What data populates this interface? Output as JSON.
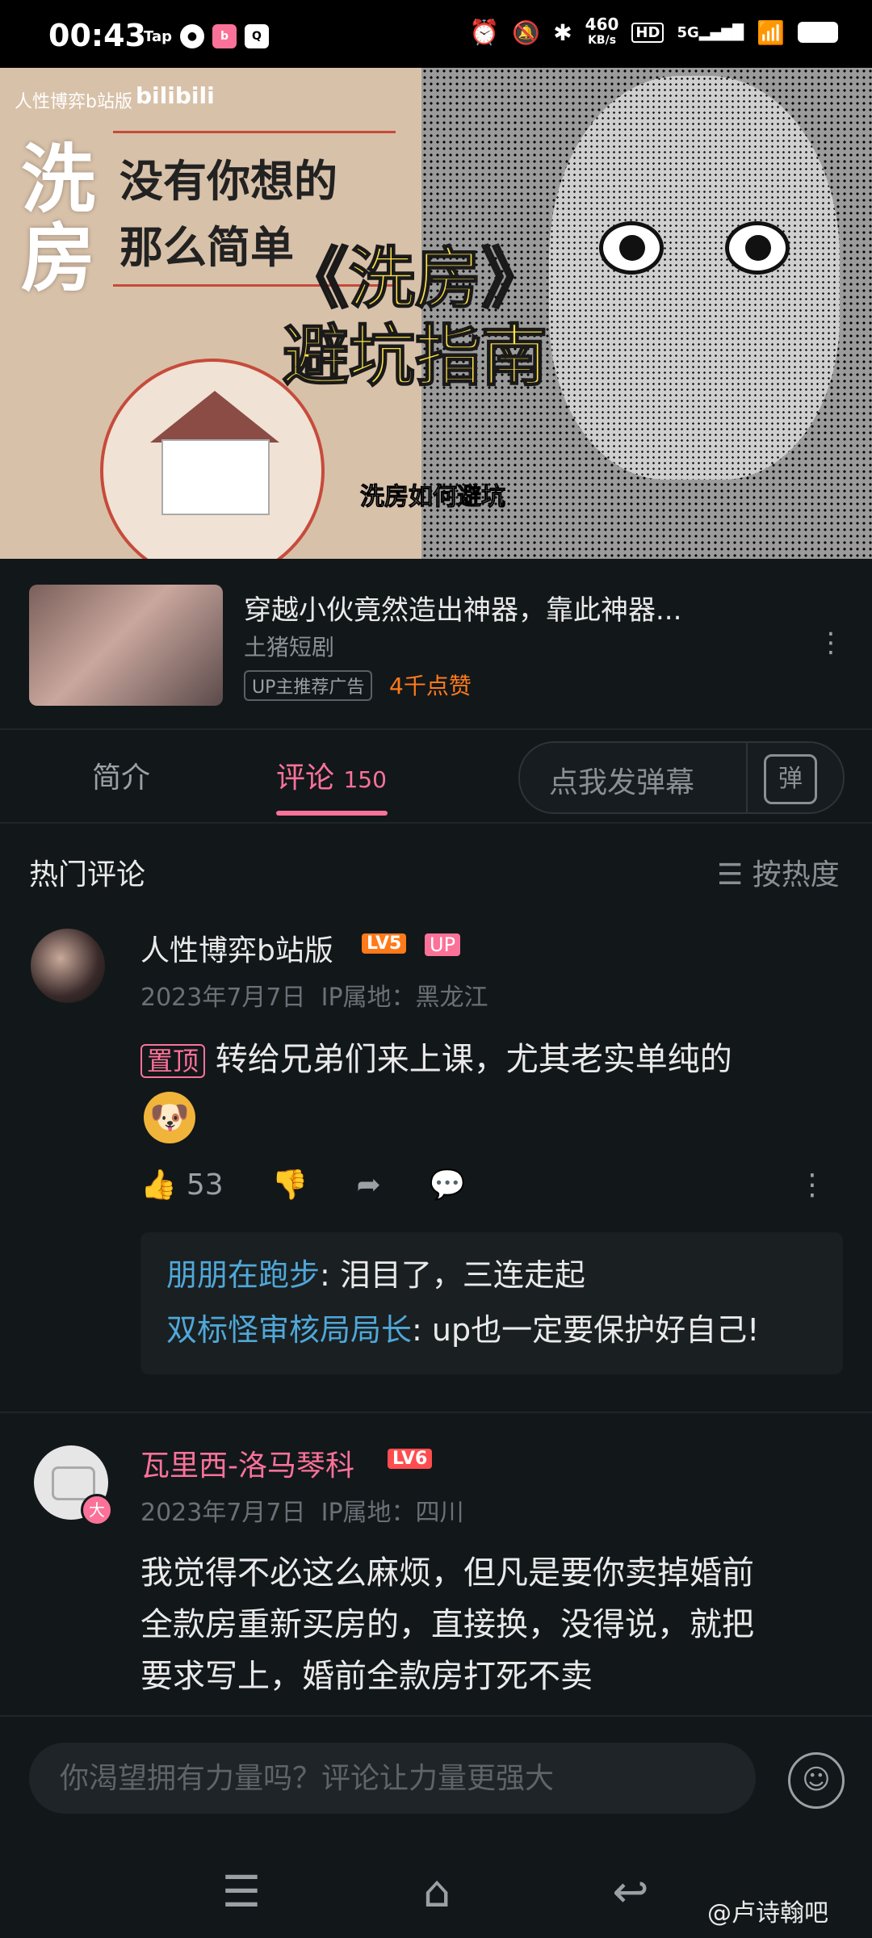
{
  "status_bar": {
    "time": "00:43",
    "icons_left": [
      "Tap",
      "message-icon",
      "app-icon",
      "qq-icon"
    ],
    "net_speed_value": "460",
    "net_speed_unit": "KB/s",
    "hd_label": "HD",
    "signal_label": "5G"
  },
  "video": {
    "caption_top": "人性博弈b站版",
    "logo": "bilibili",
    "big_text_1": "洗",
    "big_text_2": "房",
    "line1": "没有你想的",
    "line2": "那么简单",
    "overlay_title_1": "《洗房》",
    "overlay_title_2": "避坑指南",
    "subtitle": "洗房如何避坑"
  },
  "ad": {
    "title": "穿越小伙竟然造出神器，靠此神器...",
    "author": "土猪短剧",
    "tag": "UP主推荐广告",
    "likes": "4千点赞"
  },
  "tabs": {
    "intro": "简介",
    "comments": "评论",
    "comments_count": "150",
    "danmaku_placeholder": "点我发弹幕",
    "danmaku_btn": "弹"
  },
  "comments_section": {
    "title": "热门评论",
    "sort_label": "按热度"
  },
  "comments": [
    {
      "username": "人性博弈b站版",
      "level": "LV5",
      "up_tag": "UP",
      "date": "2023年7月7日",
      "ip": "IP属地：黑龙江",
      "pinned": "置顶",
      "text": "转给兄弟们来上课，尤其老实单纯的",
      "likes": "53",
      "replies": [
        {
          "name": "朋朋在跑步",
          "text": ": 泪目了，三连走起"
        },
        {
          "name": "双标怪审核局局长",
          "text": ": up也一定要保护好自己!"
        }
      ]
    },
    {
      "username": "瓦里西-洛马琴科",
      "level": "LV6",
      "badge": "大",
      "date": "2023年7月7日",
      "ip": "IP属地：四川",
      "text_lines": [
        "我觉得不必这么麻烦，但凡是要你卖掉婚前",
        "全款房重新买房的，直接换，没得说，就把",
        "要求写上，婚前全款房打死不卖"
      ]
    }
  ],
  "input": {
    "placeholder": "你渴望拥有力量吗？评论让力量更强大"
  },
  "watermark": "@卢诗翰吧",
  "colors": {
    "accent": "#fb7299",
    "reply_name": "#4fa8d8",
    "ad_likes": "#ff7a1a",
    "background": "#12171a"
  }
}
